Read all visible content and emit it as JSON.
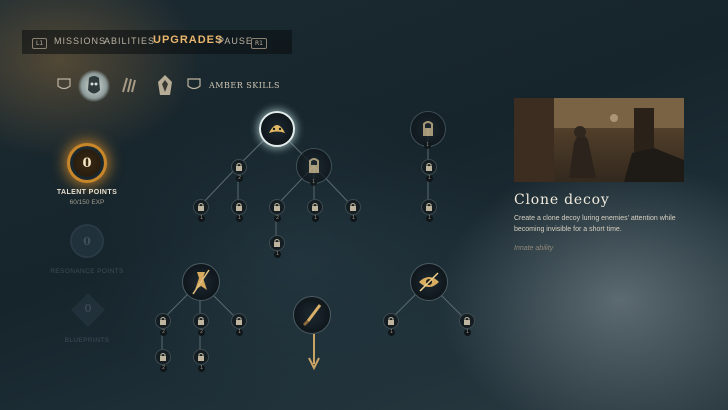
{
  "nav": {
    "left_key": "L1",
    "right_key": "R1",
    "tabs": [
      {
        "label": "MISSIONS",
        "active": false
      },
      {
        "label": "ABILITIES",
        "active": false
      },
      {
        "label": "UPGRADES",
        "active": true
      },
      {
        "label": "PAUSE",
        "active": false
      }
    ]
  },
  "categories": {
    "left_key_icon": "l-shoulder-icon",
    "right_key_icon": "r-shoulder-icon",
    "icons": [
      "blindness-ability-icon",
      "claw-ability-icon",
      "cloak-ability-icon"
    ],
    "label": "AMBER SKILLS"
  },
  "resources": {
    "talent": {
      "value": "0",
      "label": "TALENT POINTS",
      "exp": "60/150 EXP"
    },
    "resonance": {
      "value": "0",
      "label": "RESONANCE POINTS"
    },
    "blueprints": {
      "value": "0",
      "label": "BLUEPRINTS"
    }
  },
  "tree": {
    "top_left": {
      "icon": "mask-hood-icon",
      "selected": true,
      "locks": [
        "2",
        "1",
        "1",
        "2",
        "1",
        "1",
        "1"
      ]
    },
    "top_right": {
      "icon": "lock-icon",
      "locks": [
        "1",
        "1",
        "1"
      ]
    },
    "mid_left": {
      "icon": "knife-figure-icon",
      "locks": [
        "2",
        "2",
        "1",
        "2",
        "1"
      ]
    },
    "mid_center": {
      "icon": "dagger-icon"
    },
    "mid_right": {
      "icon": "eye-slash-icon",
      "locks": [
        "1",
        "1"
      ]
    }
  },
  "detail": {
    "title": "Clone decoy",
    "description": "Create a clone decoy luring enemies' attention while becoming invisible for a short time.",
    "type": "Innate ability"
  },
  "colors": {
    "accent": "#e7b56b",
    "glow": "#c8862a",
    "background": "#1c2b32"
  }
}
